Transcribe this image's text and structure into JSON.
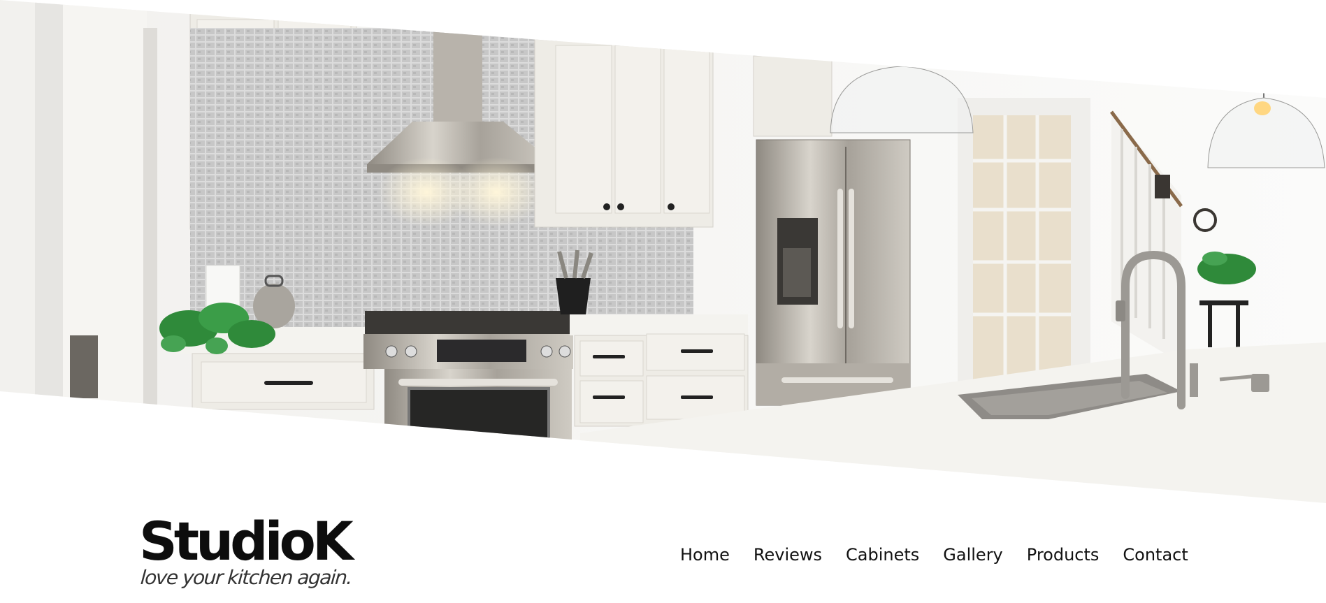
{
  "hero": {
    "image_alt": "kitchen-photo"
  },
  "brand": {
    "name": "StudioK",
    "tagline": "love your kitchen again."
  },
  "nav": {
    "items": [
      {
        "label": "Home"
      },
      {
        "label": "Reviews"
      },
      {
        "label": "Cabinets"
      },
      {
        "label": "Gallery"
      },
      {
        "label": "Products"
      },
      {
        "label": "Contact"
      }
    ]
  },
  "colors": {
    "background": "#ffffff",
    "text": "#111111",
    "cabinet": "#eeece6",
    "steel": "#b9b5ae",
    "counter": "#f4f3ef",
    "plant": "#2f8a3a"
  }
}
